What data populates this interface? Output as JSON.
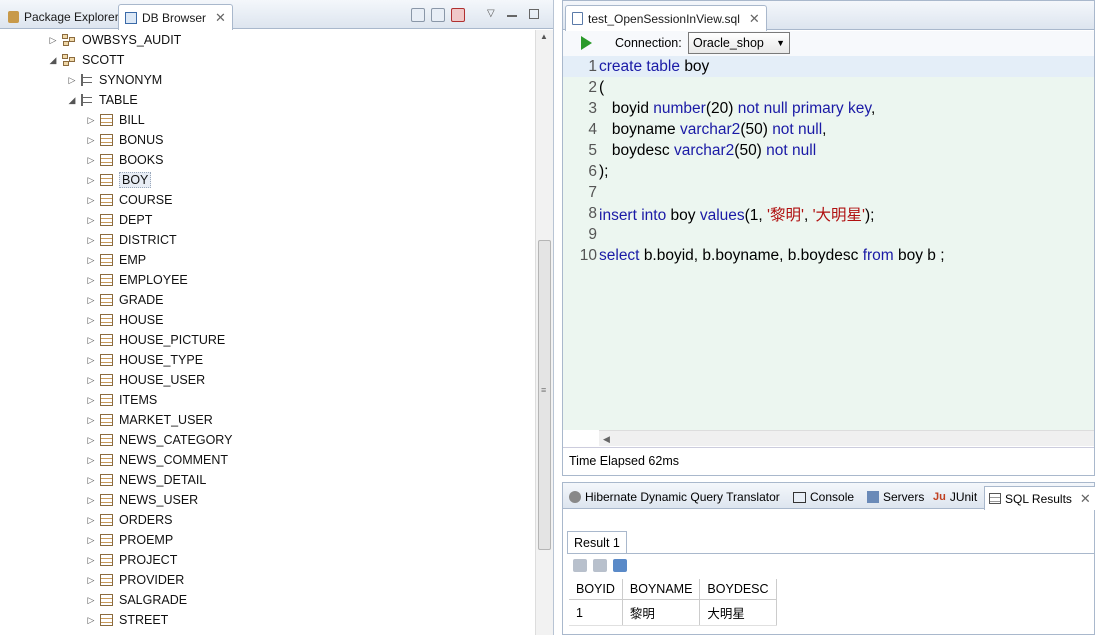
{
  "left_panel": {
    "tabs": [
      {
        "label": "Package Explorer",
        "icon": "package-icon"
      },
      {
        "label": "DB Browser",
        "icon": "db-browser-icon"
      }
    ],
    "close_glyph": "✕",
    "tree": [
      {
        "label": "OWBSYS_AUDIT",
        "kind": "schema",
        "level": 0,
        "expanded": false
      },
      {
        "label": "SCOTT",
        "kind": "schema",
        "level": 0,
        "expanded": true
      },
      {
        "label": "SYNONYM",
        "kind": "folder",
        "level": 1,
        "expanded": false
      },
      {
        "label": "TABLE",
        "kind": "folder",
        "level": 1,
        "expanded": true
      },
      {
        "label": "BILL",
        "kind": "table",
        "level": 2
      },
      {
        "label": "BONUS",
        "kind": "table",
        "level": 2
      },
      {
        "label": "BOOKS",
        "kind": "table",
        "level": 2
      },
      {
        "label": "BOY",
        "kind": "table",
        "level": 2,
        "selected": true
      },
      {
        "label": "COURSE",
        "kind": "table",
        "level": 2
      },
      {
        "label": "DEPT",
        "kind": "table",
        "level": 2
      },
      {
        "label": "DISTRICT",
        "kind": "table",
        "level": 2
      },
      {
        "label": "EMP",
        "kind": "table",
        "level": 2
      },
      {
        "label": "EMPLOYEE",
        "kind": "table",
        "level": 2
      },
      {
        "label": "GRADE",
        "kind": "table",
        "level": 2
      },
      {
        "label": "HOUSE",
        "kind": "table",
        "level": 2
      },
      {
        "label": "HOUSE_PICTURE",
        "kind": "table",
        "level": 2
      },
      {
        "label": "HOUSE_TYPE",
        "kind": "table",
        "level": 2
      },
      {
        "label": "HOUSE_USER",
        "kind": "table",
        "level": 2
      },
      {
        "label": "ITEMS",
        "kind": "table",
        "level": 2
      },
      {
        "label": "MARKET_USER",
        "kind": "table",
        "level": 2
      },
      {
        "label": "NEWS_CATEGORY",
        "kind": "table",
        "level": 2
      },
      {
        "label": "NEWS_COMMENT",
        "kind": "table",
        "level": 2
      },
      {
        "label": "NEWS_DETAIL",
        "kind": "table",
        "level": 2
      },
      {
        "label": "NEWS_USER",
        "kind": "table",
        "level": 2
      },
      {
        "label": "ORDERS",
        "kind": "table",
        "level": 2
      },
      {
        "label": "PROEMP",
        "kind": "table",
        "level": 2
      },
      {
        "label": "PROJECT",
        "kind": "table",
        "level": 2
      },
      {
        "label": "PROVIDER",
        "kind": "table",
        "level": 2
      },
      {
        "label": "SALGRADE",
        "kind": "table",
        "level": 2
      },
      {
        "label": "STREET",
        "kind": "table",
        "level": 2
      }
    ]
  },
  "editor": {
    "tab_label": "test_OpenSessionInView.sql",
    "connection_label": "Connection:",
    "connection_value": "Oracle_shop",
    "lines": [
      {
        "num": "1",
        "tokens": [
          [
            "kw",
            "create table "
          ],
          [
            "t",
            "boy"
          ]
        ]
      },
      {
        "num": "2",
        "tokens": [
          [
            "t",
            "("
          ]
        ]
      },
      {
        "num": "3",
        "tokens": [
          [
            "t",
            "   boyid "
          ],
          [
            "kw",
            "number"
          ],
          [
            "t",
            "(20) "
          ],
          [
            "kw",
            "not null primary key"
          ],
          [
            "t",
            ","
          ]
        ]
      },
      {
        "num": "4",
        "tokens": [
          [
            "t",
            "   boyname "
          ],
          [
            "kw",
            "varchar2"
          ],
          [
            "t",
            "(50) "
          ],
          [
            "kw",
            "not null"
          ],
          [
            "t",
            ","
          ]
        ]
      },
      {
        "num": "5",
        "tokens": [
          [
            "t",
            "   boydesc "
          ],
          [
            "kw",
            "varchar2"
          ],
          [
            "t",
            "(50) "
          ],
          [
            "kw",
            "not null"
          ]
        ]
      },
      {
        "num": "6",
        "tokens": [
          [
            "t",
            ");"
          ]
        ]
      },
      {
        "num": "7",
        "tokens": []
      },
      {
        "num": "8",
        "tokens": [
          [
            "kw",
            "insert into "
          ],
          [
            "t",
            "boy "
          ],
          [
            "kw",
            "values"
          ],
          [
            "t",
            "(1, "
          ],
          [
            "s",
            "'黎明'"
          ],
          [
            "t",
            ", "
          ],
          [
            "s",
            "'大明星'"
          ],
          [
            "t",
            ");"
          ]
        ]
      },
      {
        "num": "9",
        "tokens": []
      },
      {
        "num": "10",
        "tokens": [
          [
            "kw",
            "select "
          ],
          [
            "t",
            "b.boyid, b.boyname, b.boydesc "
          ],
          [
            "kw",
            "from "
          ],
          [
            "t",
            "boy b ;"
          ]
        ]
      }
    ],
    "status": "Time Elapsed 62ms"
  },
  "bottom_panel": {
    "tabs": [
      {
        "label": "Hibernate Dynamic Query Translator"
      },
      {
        "label": "Console"
      },
      {
        "label": "Servers"
      },
      {
        "label": "JUnit"
      },
      {
        "label": "SQL Results",
        "active": true
      }
    ],
    "result_tab": "Result 1",
    "columns": [
      "BOYID",
      "BOYNAME",
      "BOYDESC"
    ],
    "rows": [
      [
        "1",
        "黎明",
        "大明星"
      ]
    ]
  },
  "colors": {
    "keyword": "#1a1aa6",
    "string": "#b01010",
    "editor_bg": "#ecf6f0"
  }
}
